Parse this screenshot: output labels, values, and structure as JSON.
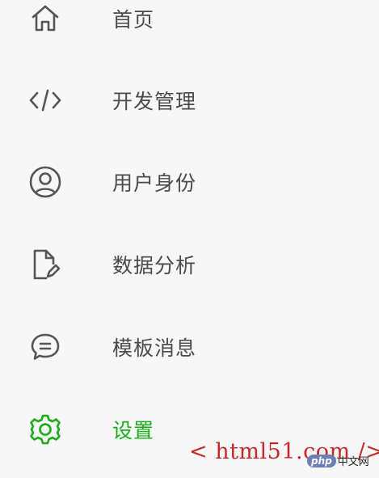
{
  "menu": {
    "items": [
      {
        "id": "home",
        "label": "首页",
        "icon": "home-icon",
        "active": false
      },
      {
        "id": "dev",
        "label": "开发管理",
        "icon": "code-icon",
        "active": false
      },
      {
        "id": "identity",
        "label": "用户身份",
        "icon": "user-circle-icon",
        "active": false
      },
      {
        "id": "analytics",
        "label": "数据分析",
        "icon": "document-edit-icon",
        "active": false
      },
      {
        "id": "messages",
        "label": "模板消息",
        "icon": "chat-bubble-icon",
        "active": false
      },
      {
        "id": "settings",
        "label": "设置",
        "icon": "gear-icon",
        "active": true
      }
    ]
  },
  "colors": {
    "background": "#f7f7f7",
    "icon": "#555555",
    "text": "#4a4a4a",
    "active": "#1aad19",
    "watermark": "#c62828"
  },
  "watermark": {
    "text": "< html51.com />",
    "badge_php": "php",
    "badge_cn": "中文网"
  }
}
